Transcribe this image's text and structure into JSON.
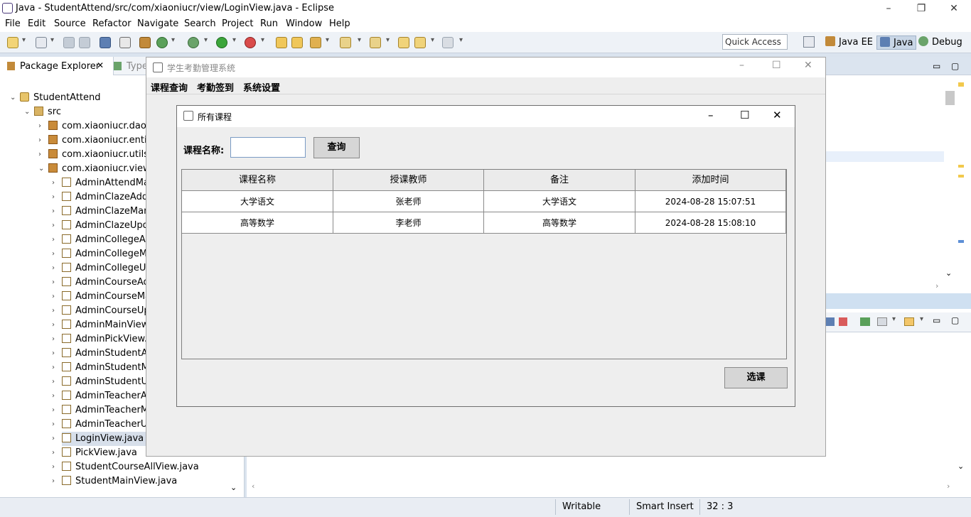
{
  "window": {
    "title": "Java - StudentAttend/src/com/xiaoniucr/view/LoginView.java - Eclipse"
  },
  "menu": [
    "File",
    "Edit",
    "Source",
    "Refactor",
    "Navigate",
    "Search",
    "Project",
    "Run",
    "Window",
    "Help"
  ],
  "toolbar": {
    "quick_access": "Quick Access",
    "perspectives": [
      "Java EE",
      "Java",
      "Debug"
    ]
  },
  "explorer": {
    "tab_package": "Package Explorer",
    "tab_type": "Type",
    "project": "StudentAttend",
    "src": "src",
    "packages": [
      "com.xiaoniucr.dao",
      "com.xiaoniucr.entity",
      "com.xiaoniucr.utils",
      "com.xiaoniucr.view"
    ],
    "files": [
      "AdminAttendMan",
      "AdminClazeAddV",
      "AdminClazeMana",
      "AdminClazeUpda",
      "AdminCollegeAdc",
      "AdminCollegeMa",
      "AdminCollegeUpc",
      "AdminCourseAdd",
      "AdminCourseMar",
      "AdminCourseUpc",
      "AdminMainView.j",
      "AdminPickView.ja",
      "AdminStudentAdc",
      "AdminStudentMa",
      "AdminStudentUpc",
      "AdminTeacherAd",
      "AdminTeacherMa",
      "AdminTeacherUp",
      "LoginView.java",
      "PickView.java",
      "StudentCourseAllView.java",
      "StudentMainView.java"
    ]
  },
  "status": {
    "writable": "Writable",
    "insert": "Smart Insert",
    "position": "32 : 3"
  },
  "app": {
    "title": "学生考勤管理系统",
    "menu": [
      "课程查询",
      "考勤签到",
      "系统设置"
    ]
  },
  "dialog": {
    "title": "所有课程",
    "search_label": "课程名称:",
    "search_value": "",
    "query_button": "查询",
    "select_button": "选课",
    "columns": [
      "课程名称",
      "授课教师",
      "备注",
      "添加时间"
    ],
    "rows": [
      [
        "大学语文",
        "张老师",
        "大学语文",
        "2024-08-28 15:07:51"
      ],
      [
        "高等数学",
        "李老师",
        "高等数学",
        "2024-08-28 15:08:10"
      ]
    ]
  }
}
